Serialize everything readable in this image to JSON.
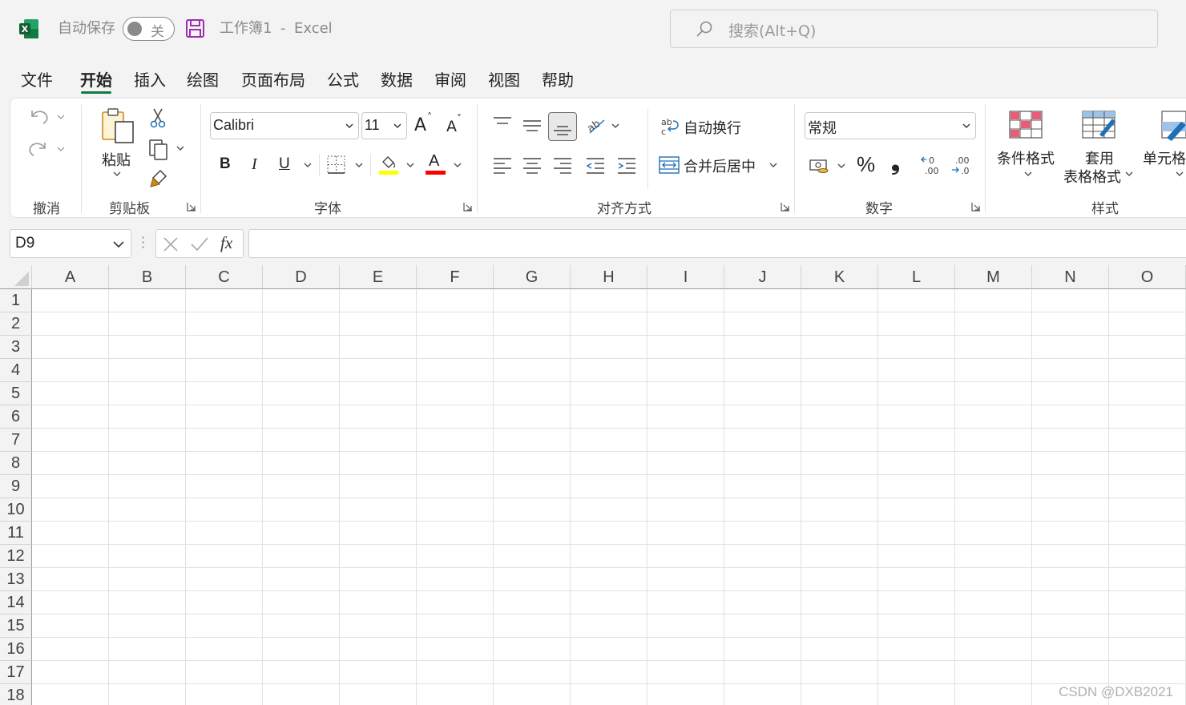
{
  "titlebar": {
    "autosave_label": "自动保存",
    "autosave_state": "关",
    "workbook": "工作簿1",
    "separator": "-",
    "app": "Excel",
    "search_placeholder": "搜索(Alt+Q)"
  },
  "tabs": [
    "文件",
    "开始",
    "插入",
    "绘图",
    "页面布局",
    "公式",
    "数据",
    "审阅",
    "视图",
    "帮助"
  ],
  "active_tab": "开始",
  "ribbon": {
    "groups": {
      "undo": "撤消",
      "clipboard": "剪贴板",
      "font": "字体",
      "alignment": "对齐方式",
      "number": "数字",
      "styles": "样式"
    },
    "paste_label": "粘贴",
    "font_name": "Calibri",
    "font_size": "11",
    "grow_font": "A",
    "shrink_font": "A",
    "bold": "B",
    "italic": "I",
    "underline": "U",
    "font_color_letter": "A",
    "wrap_text": "自动换行",
    "merge_center": "合并后居中",
    "number_format": "常规",
    "percent": "%",
    "comma": "❟",
    "conditional_format": "条件格式",
    "format_table_line1": "套用",
    "format_table_line2": "表格格式",
    "cell_styles": "单元格",
    "fill_color": "#ffff00",
    "text_color": "#ff0000"
  },
  "formula_bar": {
    "name_box": "D9",
    "fx": "fx",
    "formula": ""
  },
  "sheet": {
    "columns": [
      "A",
      "B",
      "C",
      "D",
      "E",
      "F",
      "G",
      "H",
      "I",
      "J",
      "K",
      "L",
      "M",
      "N",
      "O"
    ],
    "rows": [
      "1",
      "2",
      "3",
      "4",
      "5",
      "6",
      "7",
      "8",
      "9",
      "10",
      "11",
      "12",
      "13",
      "14",
      "15",
      "16",
      "17",
      "18"
    ]
  },
  "watermark": "CSDN @DXB2021"
}
